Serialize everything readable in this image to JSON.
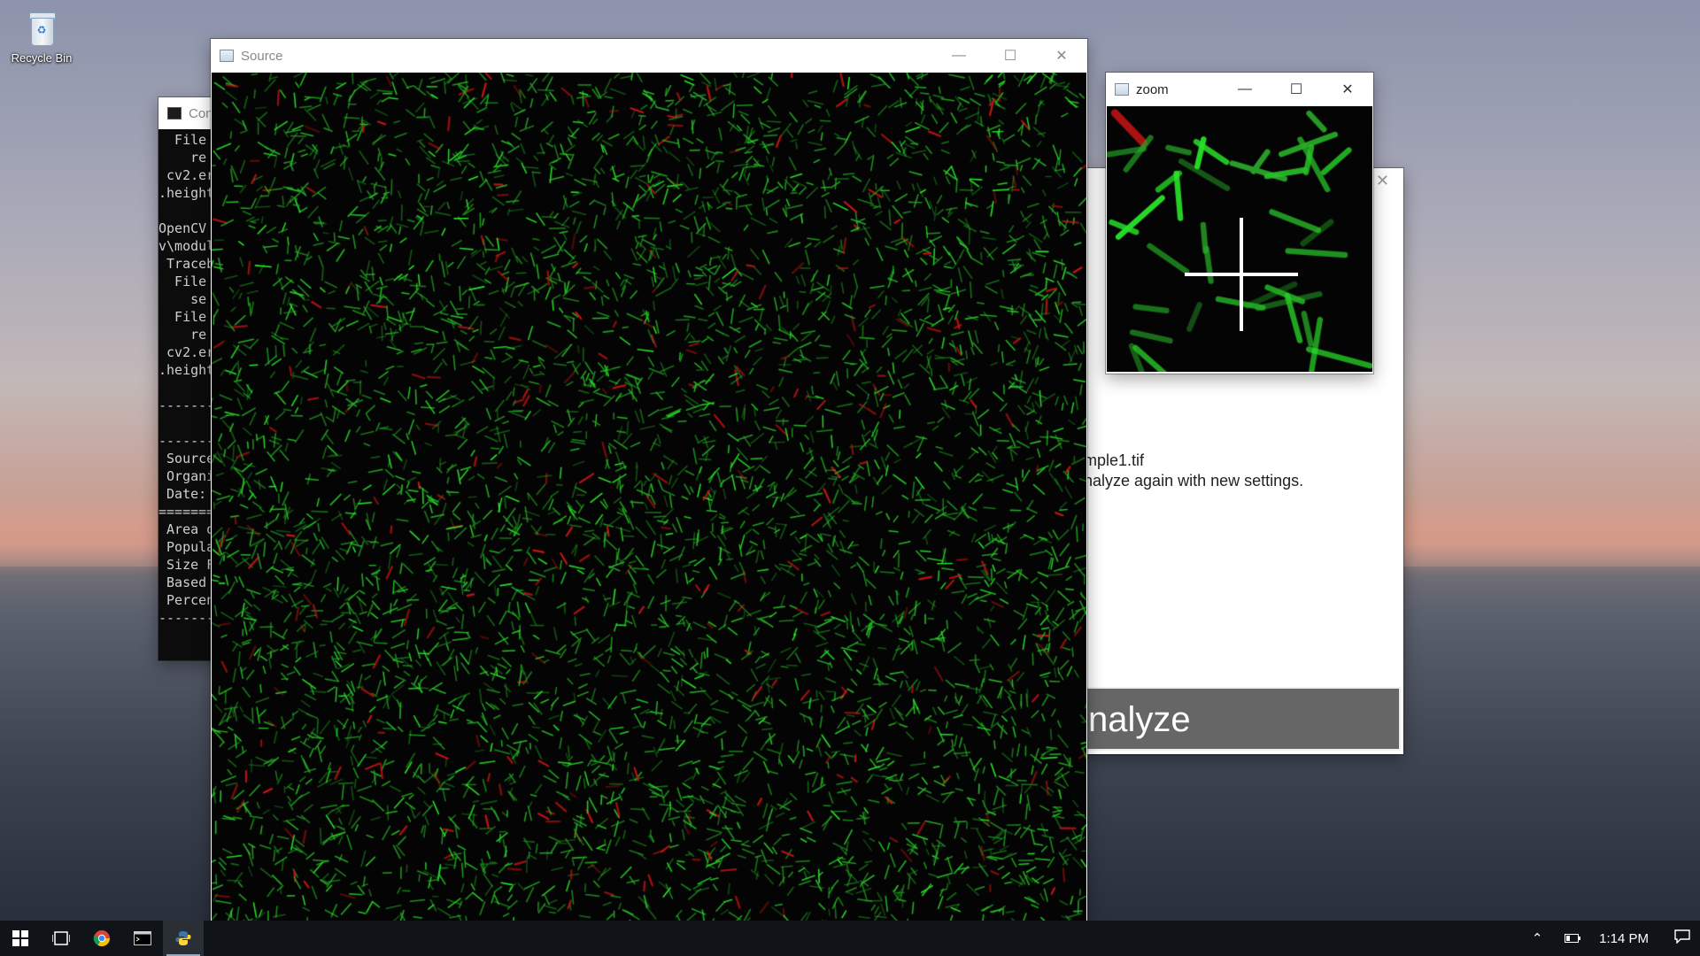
{
  "desktop": {
    "icons": [
      {
        "label": "Recycle Bin",
        "icon": "recycle-bin-icon"
      }
    ]
  },
  "console_window": {
    "title": "Con",
    "lines": [
      "  File",
      "    re",
      " cv2.er",
      ".height",
      "",
      "OpenCV",
      "v\\modul",
      " Traceb",
      "  File",
      "    se",
      "  File",
      "    re",
      " cv2.er",
      ".height",
      "",
      "-------",
      "",
      "-------",
      " Source",
      " Organi",
      " Date:",
      "=======",
      " Area o",
      " Popula",
      " Size F",
      " Based",
      " Percen",
      "-------"
    ]
  },
  "source_window": {
    "title": "Source",
    "controls": {
      "minimize": "—",
      "maximize": "☐",
      "close": "✕"
    },
    "colors": {
      "background": "#040404",
      "green_cells": "#2fbf2f",
      "red_cells": "#c41a1a"
    }
  },
  "zoom_window": {
    "title": "zoom",
    "controls": {
      "minimize": "—",
      "maximize": "☐",
      "close": "✕"
    }
  },
  "analyzer_window": {
    "file_line": "mple1.tif",
    "info_line": "nalyze again with new settings.",
    "analyze_button": "nalyze",
    "close": "✕"
  },
  "taskbar": {
    "apps": [
      {
        "name": "start-button",
        "icon": "windows-logo-icon"
      },
      {
        "name": "task-view-button",
        "icon": "task-view-icon"
      },
      {
        "name": "chrome-button",
        "icon": "chrome-icon"
      },
      {
        "name": "console-button",
        "icon": "cmd-icon"
      },
      {
        "name": "python-button",
        "icon": "python-icon"
      }
    ],
    "clock": "1:14 PM"
  }
}
